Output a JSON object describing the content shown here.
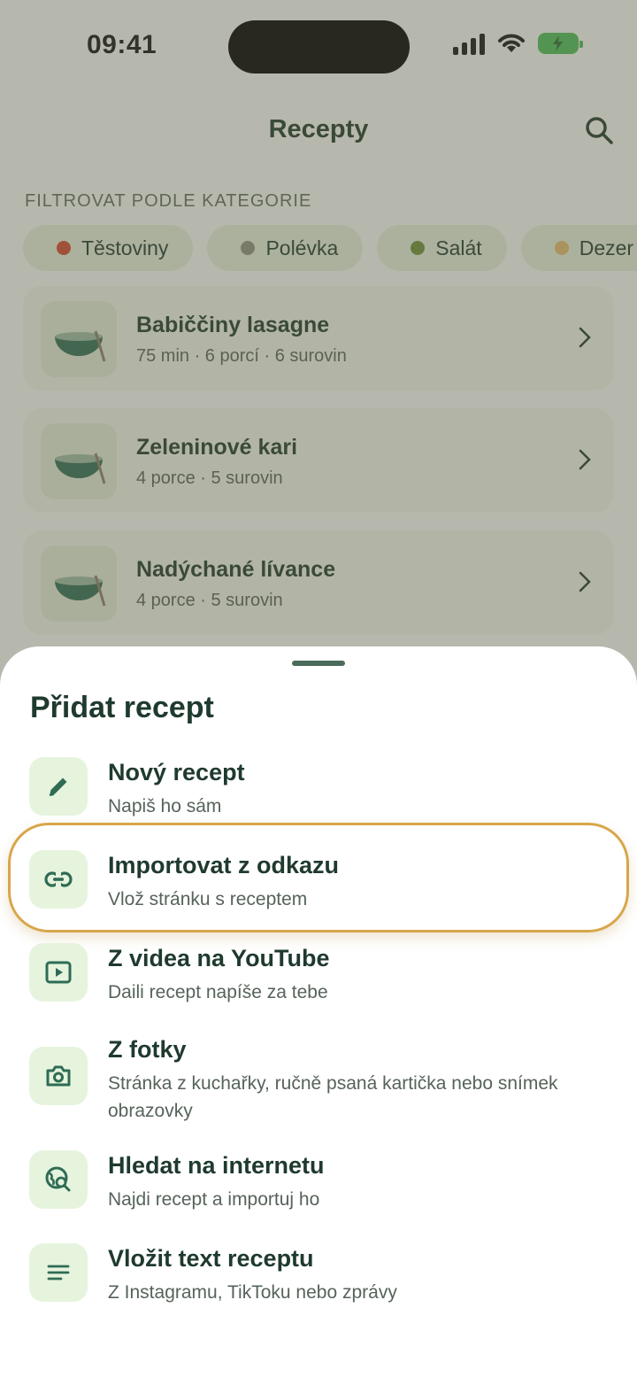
{
  "status_bar": {
    "time": "09:41"
  },
  "header": {
    "title": "Recepty",
    "search_icon": "search-icon"
  },
  "filter": {
    "label": "FILTROVAT PODLE KATEGORIE",
    "chips": [
      {
        "label": "Těstoviny",
        "icon": "tomato-icon",
        "color": "#d0452f"
      },
      {
        "label": "Polévka",
        "icon": "soup-icon",
        "color": "#8a8f7f"
      },
      {
        "label": "Salát",
        "icon": "salad-icon",
        "color": "#6b8e3a"
      },
      {
        "label": "Dezer",
        "icon": "cake-icon",
        "color": "#e0b86a"
      }
    ]
  },
  "recipes": [
    {
      "name": "Babiččiny lasagne",
      "meta": "75 min · 6 porcí · 6 surovin"
    },
    {
      "name": "Zeleninové kari",
      "meta": "4 porce · 5 surovin"
    },
    {
      "name": "Nadýchané lívance",
      "meta": "4 porce · 5 surovin"
    }
  ],
  "sheet": {
    "title": "Přidat recept",
    "options": [
      {
        "title": "Nový recept",
        "subtitle": "Napiš ho sám",
        "icon": "pencil-icon"
      },
      {
        "title": "Importovat z odkazu",
        "subtitle": "Vlož stránku s receptem",
        "icon": "link-icon"
      },
      {
        "title": "Z videa na YouTube",
        "subtitle": "Daili recept napíše za tebe",
        "icon": "play-icon"
      },
      {
        "title": "Z fotky",
        "subtitle": "Stránka z kuchařky, ručně psaná kartička nebo snímek obrazovky",
        "icon": "camera-icon"
      },
      {
        "title": "Hledat na internetu",
        "subtitle": "Najdi recept a importuj ho",
        "icon": "globe-search-icon"
      },
      {
        "title": "Vložit text receptu",
        "subtitle": "Z Instagramu, TikToku nebo zprávy",
        "icon": "text-lines-icon"
      }
    ]
  },
  "colors": {
    "accent": "#2f6b55",
    "icon_bg": "#e6f4dd",
    "highlight": "#d8a64a"
  }
}
